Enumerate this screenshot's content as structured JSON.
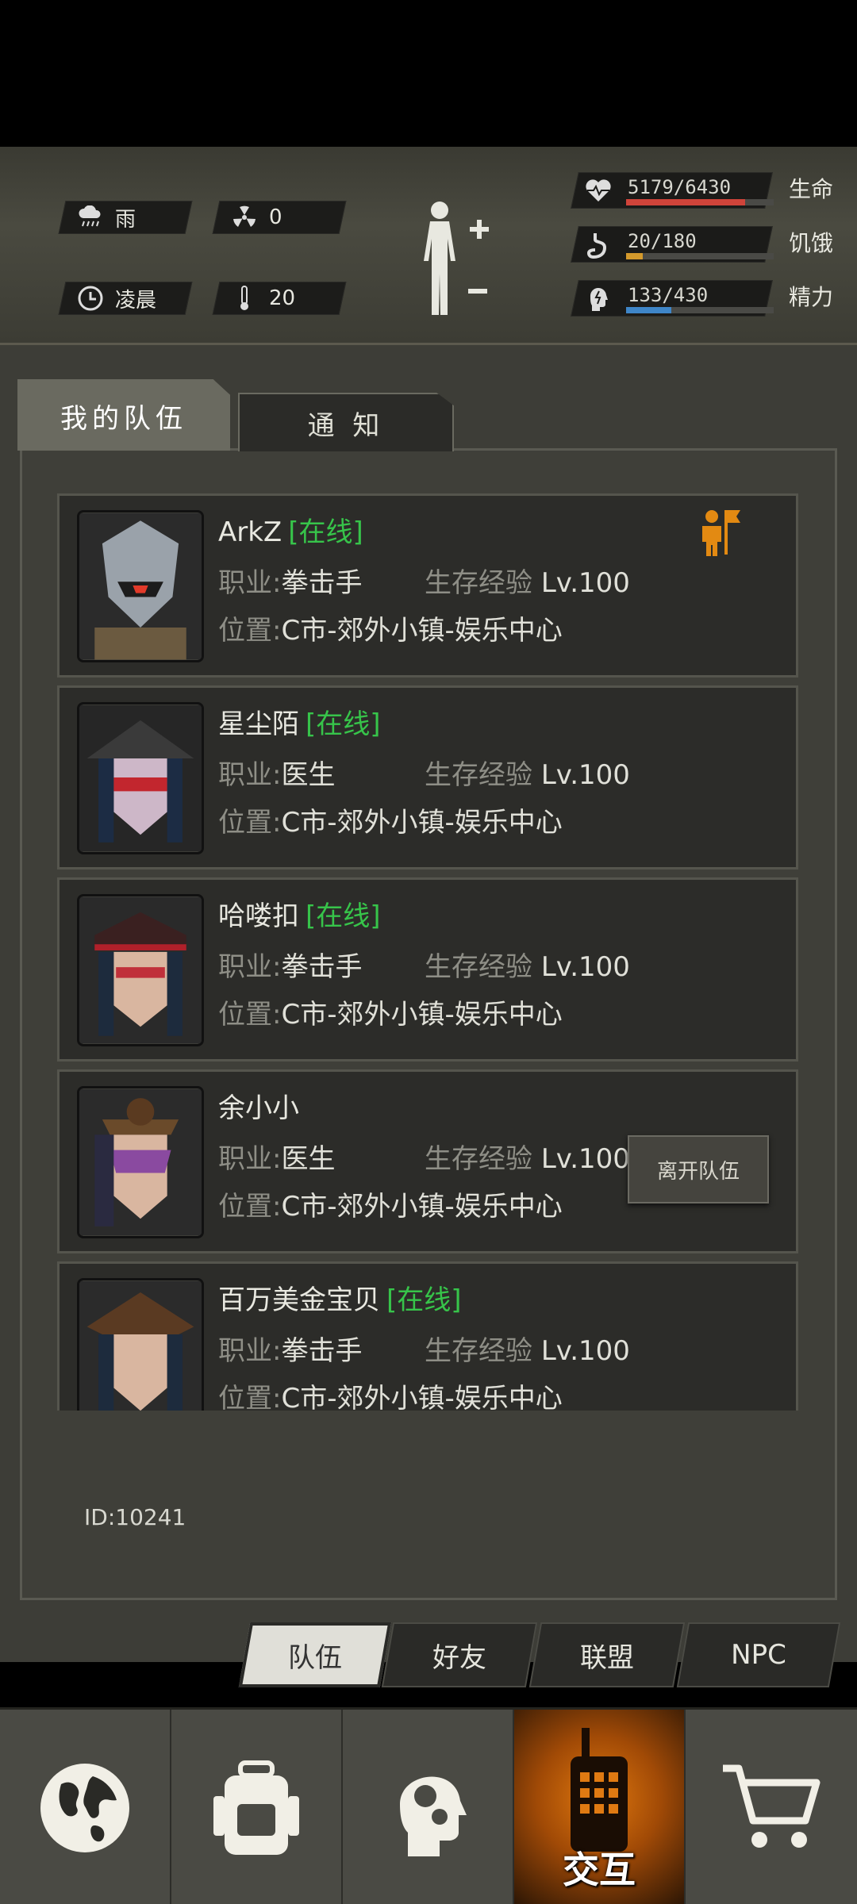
{
  "hud": {
    "weather": "雨",
    "radiation": "0",
    "time_of_day": "凌晨",
    "temperature": "20",
    "stats": [
      {
        "label": "生命",
        "value": "5179/6430",
        "fraction": 0.805,
        "color": "#d0443a",
        "icon": "heart-pulse-icon"
      },
      {
        "label": "饥饿",
        "value": "20/180",
        "fraction": 0.111,
        "color": "#d49a2c",
        "icon": "stomach-icon"
      },
      {
        "label": "精力",
        "value": "133/430",
        "fraction": 0.309,
        "color": "#3f86c8",
        "icon": "head-energy-icon"
      }
    ]
  },
  "tabs": {
    "team": "我的队伍",
    "notice": "通 知"
  },
  "labels": {
    "job": "职业:",
    "exp": "生存经验",
    "loc": "位置:",
    "online": "[在线]",
    "leave": "离开队伍"
  },
  "members": [
    {
      "name": "ArkZ",
      "online": true,
      "job": "拳击手",
      "level": "Lv.100",
      "location": "C市-郊外小镇-娱乐中心",
      "leader": true
    },
    {
      "name": "星尘陌",
      "online": true,
      "job": "医生",
      "level": "Lv.100",
      "location": "C市-郊外小镇-娱乐中心"
    },
    {
      "name": "哈喽扣",
      "online": true,
      "job": "拳击手",
      "level": "Lv.100",
      "location": "C市-郊外小镇-娱乐中心"
    },
    {
      "name": "余小小",
      "online": false,
      "job": "医生",
      "level": "Lv.100",
      "location": "C市-郊外小镇-娱乐中心",
      "self": true
    },
    {
      "name": "百万美金宝贝",
      "online": true,
      "job": "拳击手",
      "level": "Lv.100",
      "location": "C市-郊外小镇-娱乐中心"
    }
  ],
  "player_id": "ID:10241",
  "subtabs": [
    "队伍",
    "好友",
    "联盟",
    "NPC"
  ],
  "nav": {
    "interact_label": "交互"
  }
}
